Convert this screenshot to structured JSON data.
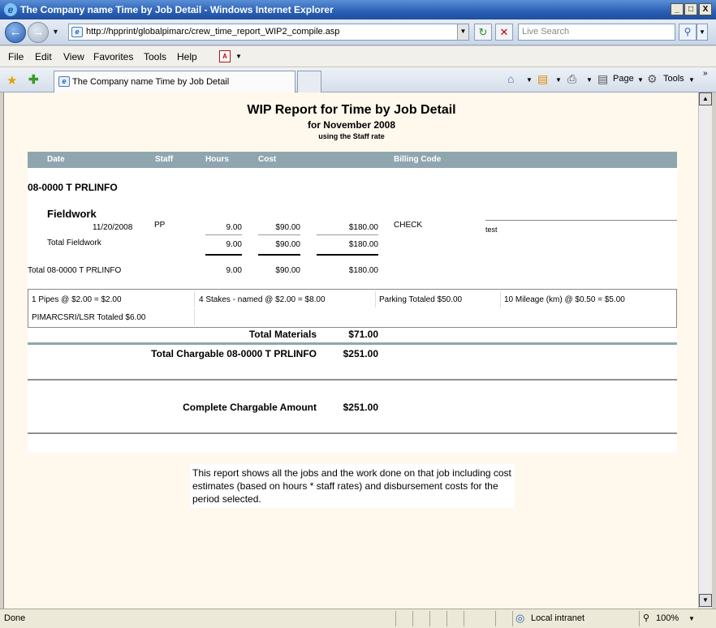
{
  "window": {
    "title": "The Company name Time by Job Detail - Windows Internet Explorer",
    "min": "_",
    "max": "□",
    "close": "X"
  },
  "nav": {
    "url": "http://hpprint/globalpimarc/crew_time_report_WIP2_compile.asp",
    "search_placeholder": "Live Search"
  },
  "menu": {
    "items": [
      "File",
      "Edit",
      "View",
      "Favorites",
      "Tools",
      "Help"
    ]
  },
  "tabs": {
    "active_label": "The Company name Time by Job Detail"
  },
  "commands": {
    "page": "Page",
    "tools": "Tools"
  },
  "report": {
    "title": "WIP Report for Time by Job Detail",
    "subtitle": "for November 2008",
    "rate_note": "using the Staff rate",
    "columns": {
      "date": "Date",
      "staff": "Staff",
      "hours": "Hours",
      "cost": "Cost",
      "billing_code": "Billing Code"
    },
    "job": "08-0000 T  PRLINFO",
    "section": "Fieldwork",
    "entry": {
      "date": "11/20/2008",
      "staff": "PP",
      "hours": "9.00",
      "cost": "$90.00",
      "charge": "$180.00",
      "billing_code": "CHECK",
      "note": "test"
    },
    "section_total": {
      "label": "Total Fieldwork",
      "hours": "9.00",
      "cost": "$90.00",
      "charge": "$180.00"
    },
    "job_total": {
      "label": "Total 08-0000 T  PRLINFO",
      "hours": "9.00",
      "cost": "$90.00",
      "charge": "$180.00"
    },
    "materials": {
      "row1": [
        "1  Pipes @ $2.00 = $2.00",
        "4  Stakes - named @ $2.00 = $8.00",
        "Parking Totaled  $50.00",
        "10  Mileage (km) @ $0.50 = $5.00"
      ],
      "row2": [
        "PIMARCSRI/LSR Totaled  $6.00"
      ]
    },
    "total_materials": {
      "label": "Total Materials",
      "value": "$71.00"
    },
    "total_chargable": {
      "label": "Total Chargable 08-0000 T  PRLINFO",
      "value": "$251.00"
    },
    "complete_chargable": {
      "label": "Complete Chargable Amount",
      "value": "$251.00"
    },
    "description": "This report shows all the jobs and the work done on that job including cost estimates (based on hours * staff rates) and disbursement costs for the period selected."
  },
  "status": {
    "text": "Done",
    "zone": "Local intranet",
    "zoom": "100%"
  }
}
